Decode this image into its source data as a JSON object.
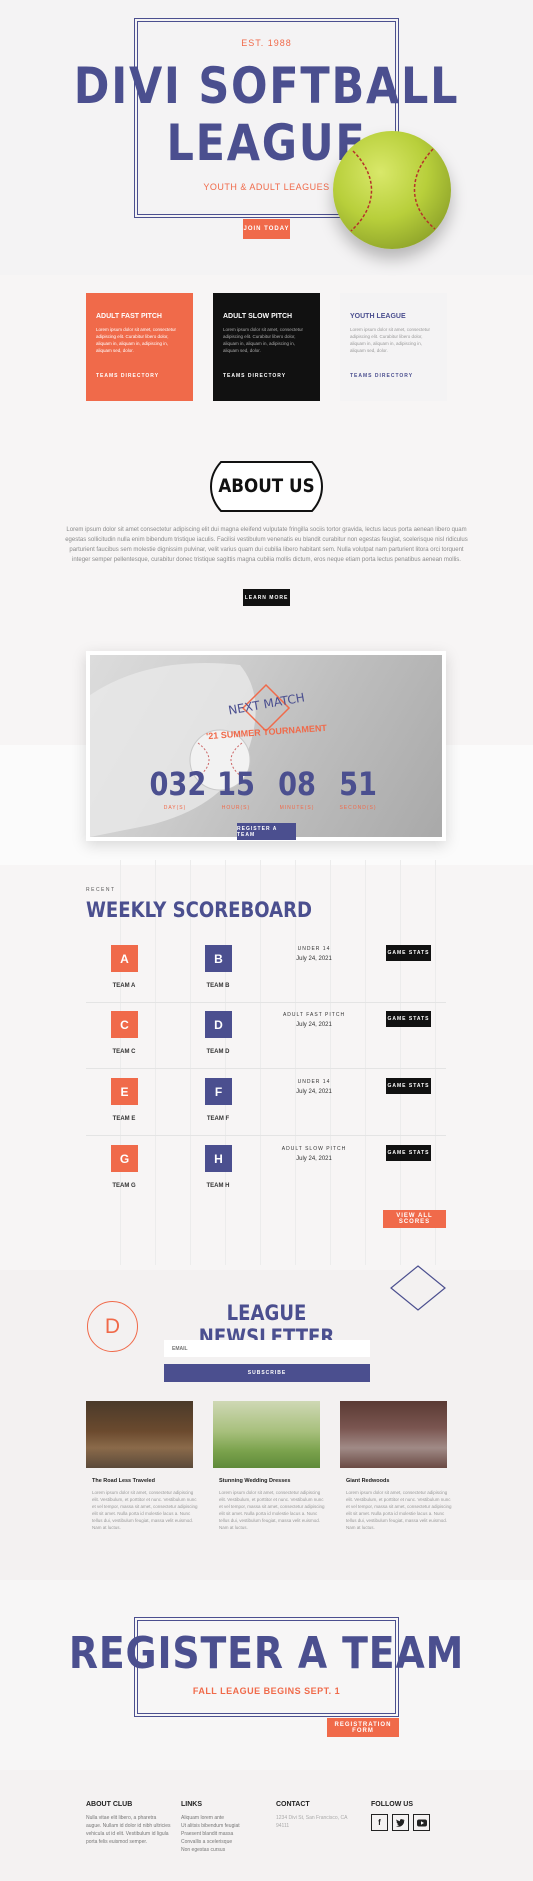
{
  "hero": {
    "est": "EST. 1988",
    "title_line1": "DIVI SOFTBALL",
    "title_line2": "LEAGUE",
    "subtitle": "YOUTH & ADULT LEAGUES",
    "cta": "JOIN TODAY"
  },
  "leagues": [
    {
      "title": "ADULT FAST PITCH",
      "body": "Lorem ipsum dolor sit amet, consectetur adipiscing elit. Curabitur libero dolor, aliquam in, aliquam in, adipiscing in, aliquam sed, dolor.",
      "link": "TEAMS DIRECTORY",
      "bg": "#f06a4a",
      "fg": "#ffffff"
    },
    {
      "title": "ADULT SLOW PITCH",
      "body": "Lorem ipsum dolor sit amet, consectetur adipiscing elit. Curabitur libero dolor, aliquam in, aliquam in, adipiscing in, aliquam sed, dolor.",
      "link": "TEAMS DIRECTORY",
      "bg": "#111111",
      "fg": "#ffffff"
    },
    {
      "title": "YOUTH LEAGUE",
      "body": "Lorem ipsum dolor sit amet, consectetur adipiscing elit. Curabitur libero dolor, aliquam in, aliquam in, adipiscing in, aliquam sed, dolor.",
      "link": "TEAMS DIRECTORY",
      "bg": "#f4f3f4",
      "fg": "#4b4f8f"
    }
  ],
  "about": {
    "heading": "ABOUT US",
    "text": "Lorem ipsum dolor sit amet consectetur adipiscing elit dui magna eleifend vulputate fringilla sociis tortor gravida, lectus lacus porta aenean libero quam egestas sollicitudin nulla enim bibendum tristique iaculis. Facilisi vestibulum venenatis eu blandit curabitur non egestas feugiat, scelerisque nisl ridiculus parturient faucibus sem molestie dignissim pulvinar, velit varius quam dui cubilia libero habitant sem. Nulla volutpat nam parturient litora orci torquent integer semper pellentesque, curabitur donec tristique sagittis magna cubilia mollis dictum, eros neque etiam porta lectus penatibus aenean mollis.",
    "button": "LEARN MORE"
  },
  "match": {
    "label": "NEXT MATCH",
    "event": "'21 SUMMER TOURNAMENT",
    "countdown": [
      {
        "value": "032",
        "label": "DAY(S)"
      },
      {
        "value": "15",
        "label": "HOUR(S)"
      },
      {
        "value": "08",
        "label": "MINUTE(S)"
      },
      {
        "value": "51",
        "label": "SECOND(S)"
      }
    ],
    "button": "REGISTER A TEAM"
  },
  "scoreboard": {
    "eyebrow": "RECENT",
    "title": "WEEKLY SCOREBOARD",
    "games": [
      {
        "home_letter": "A",
        "home": "TEAM A",
        "away_letter": "B",
        "away": "TEAM B",
        "league": "UNDER 14",
        "date": "July 24, 2021",
        "button": "GAME STATS"
      },
      {
        "home_letter": "C",
        "home": "TEAM C",
        "away_letter": "D",
        "away": "TEAM D",
        "league": "ADULT FAST PITCH",
        "date": "July 24, 2021",
        "button": "GAME STATS"
      },
      {
        "home_letter": "E",
        "home": "TEAM E",
        "away_letter": "F",
        "away": "TEAM F",
        "league": "UNDER 14",
        "date": "July 24, 2021",
        "button": "GAME STATS"
      },
      {
        "home_letter": "G",
        "home": "TEAM G",
        "away_letter": "H",
        "away": "TEAM H",
        "league": "ADULT SLOW PITCH",
        "date": "July 24, 2021",
        "button": "GAME STATS"
      }
    ],
    "view_all": "VIEW ALL SCORES"
  },
  "newsletter": {
    "logo_letter": "D",
    "title": "LEAGUE NEWSLETTER",
    "email_placeholder": "EMAIL",
    "subscribe": "SUBSCRIBE"
  },
  "posts": [
    {
      "title": "The Road Less Traveled",
      "body": "Lorem ipsum dolor sit amet, consectetur adipiscing elit. Vestibulum, et porttitor et nunc. Vestibulum nunc et vel tempor, massa sit amet, consectetur adipiscing elit sit amet. Nulla porta id molestie lacus a. Nunc tellus dui, vestibulum feugiat, massa velit euismod. Nam at luctus."
    },
    {
      "title": "Stunning Wedding Dresses",
      "body": "Lorem ipsum dolor sit amet, consectetur adipiscing elit. Vestibulum, et porttitor et nunc. Vestibulum nunc et vel tempor, massa sit amet, consectetur adipiscing elit sit amet. Nulla porta id molestie lacus a. Nunc tellus dui, vestibulum feugiat, massa velit euismod. Nam at luctus."
    },
    {
      "title": "Giant Redwoods",
      "body": "Lorem ipsum dolor sit amet, consectetur adipiscing elit. Vestibulum, et porttitor et nunc. Vestibulum nunc et vel tempor, massa sit amet, consectetur adipiscing elit sit amet. Nulla porta id molestie lacus a. Nunc tellus dui, vestibulum feugiat, massa velit euismod. Nam at luctus."
    }
  ],
  "register": {
    "title": "REGISTER A TEAM",
    "subtitle": "FALL LEAGUE BEGINS SEPT. 1",
    "button": "REGISTRATION FORM"
  },
  "footer": {
    "about_title": "ABOUT CLUB",
    "about_text": "Nulla vitae elit libero, a pharetra augue. Nullam id dolor id nibh ultricies vehicula ut id elit. Vestibulum id ligula porta felis euismod semper.",
    "links_title": "LINKS",
    "links": [
      "Aliquam lorem ante",
      "Ut alitsis bibendum feugiat",
      "Praesent blandit massa",
      "Convallis a scelerisque",
      "Non egestas cursus"
    ],
    "contact_title": "CONTACT",
    "contact_text": "1234 Divi St, San Francisco, CA 94111",
    "follow_title": "FOLLOW US",
    "social": [
      "f",
      "t",
      "yt"
    ]
  }
}
